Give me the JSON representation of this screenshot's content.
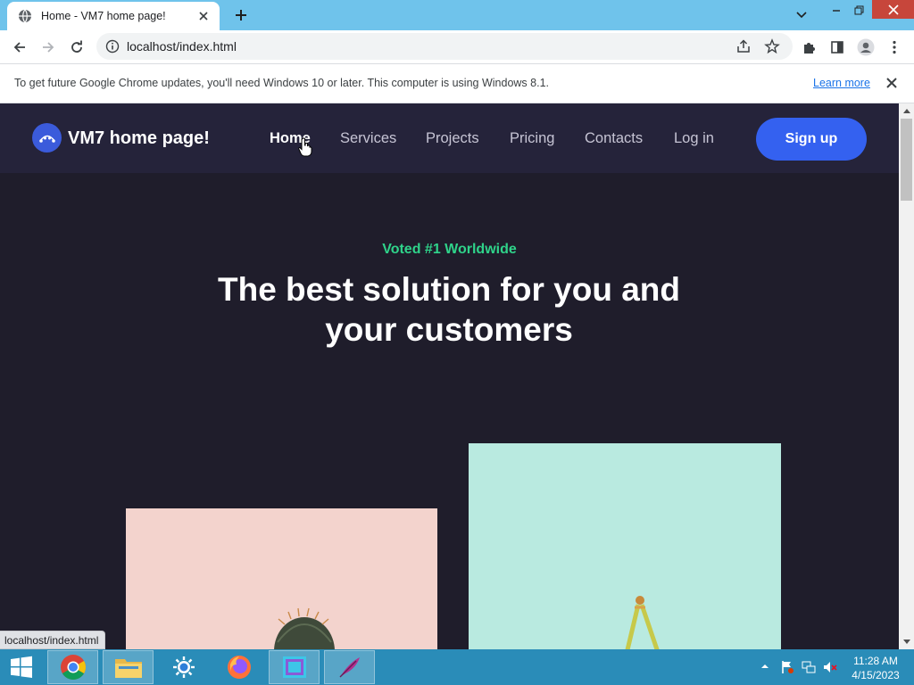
{
  "browser": {
    "tab_title": "Home - VM7 home page!",
    "url": "localhost/index.html",
    "infobar_message": "To get future Google Chrome updates, you'll need Windows 10 or later. This computer is using Windows 8.1.",
    "infobar_link": "Learn more",
    "status_url": "localhost/index.html"
  },
  "site": {
    "brand": "VM7 home page!",
    "nav": [
      {
        "label": "Home",
        "active": true
      },
      {
        "label": "Services"
      },
      {
        "label": "Projects"
      },
      {
        "label": "Pricing"
      },
      {
        "label": "Contacts"
      },
      {
        "label": "Log in"
      }
    ],
    "signup": "Sign up",
    "hero": {
      "eyebrow": "Voted #1 Worldwide",
      "title": "The best solution for you and your customers"
    }
  },
  "taskbar": {
    "apps": [
      "chrome-icon",
      "file-explorer-icon",
      "control-panel-icon",
      "firefox-icon",
      "app-window-icon",
      "feather-app-icon"
    ],
    "time": "11:28 AM",
    "date": "4/15/2023"
  },
  "colors": {
    "titlebar": "#6fc3eb",
    "page_bg": "#1f1d2b",
    "nav_bg": "#25233a",
    "accent": "#3461f0",
    "eyebrow": "#2fd38a",
    "card_pink": "#f3d3cd",
    "card_mint": "#b4e9dd",
    "taskbar": "#2a8cb8"
  }
}
